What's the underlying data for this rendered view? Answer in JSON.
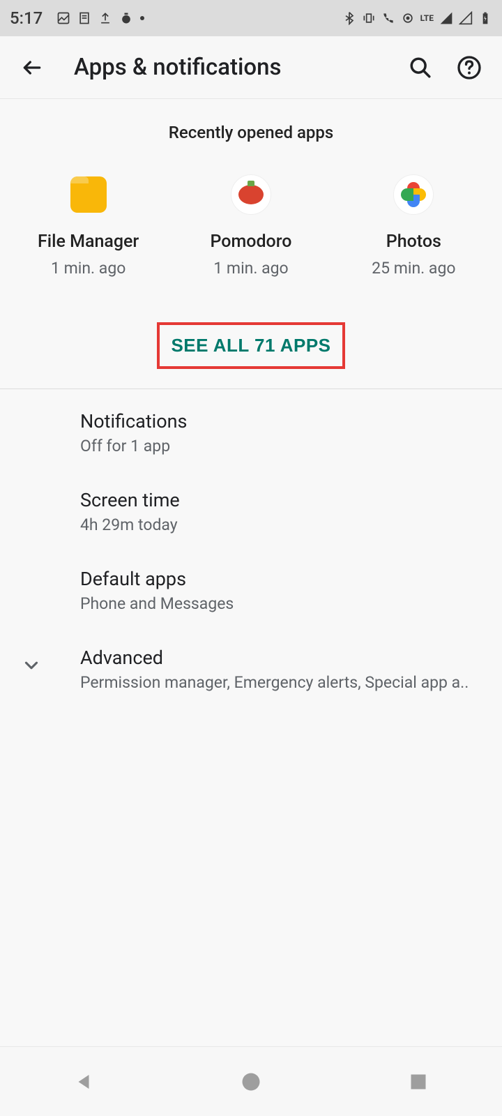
{
  "status_bar": {
    "time": "5:17",
    "left_icons": [
      "image-icon",
      "document-icon",
      "upload-icon",
      "timer-icon",
      "dot-icon"
    ],
    "right_icons": [
      "bluetooth-icon",
      "vibrate-icon",
      "volte-icon",
      "hotspot-icon",
      "lte-icon",
      "signal-icon",
      "signal2-icon",
      "battery-icon"
    ],
    "lte_label": "LTE"
  },
  "header": {
    "title": "Apps & notifications"
  },
  "recent": {
    "heading": "Recently opened apps",
    "apps": [
      {
        "name": "File Manager",
        "time": "1 min. ago"
      },
      {
        "name": "Pomodoro",
        "time": "1 min. ago"
      },
      {
        "name": "Photos",
        "time": "25 min. ago"
      }
    ],
    "see_all": "SEE ALL 71 APPS"
  },
  "items": [
    {
      "title": "Notifications",
      "sub": "Off for 1 app"
    },
    {
      "title": "Screen time",
      "sub": "4h 29m today"
    },
    {
      "title": "Default apps",
      "sub": "Phone and Messages"
    },
    {
      "title": "Advanced",
      "sub": "Permission manager, Emergency alerts, Special app a.."
    }
  ],
  "colors": {
    "accent": "#00796b",
    "highlight_border": "#e53935"
  }
}
